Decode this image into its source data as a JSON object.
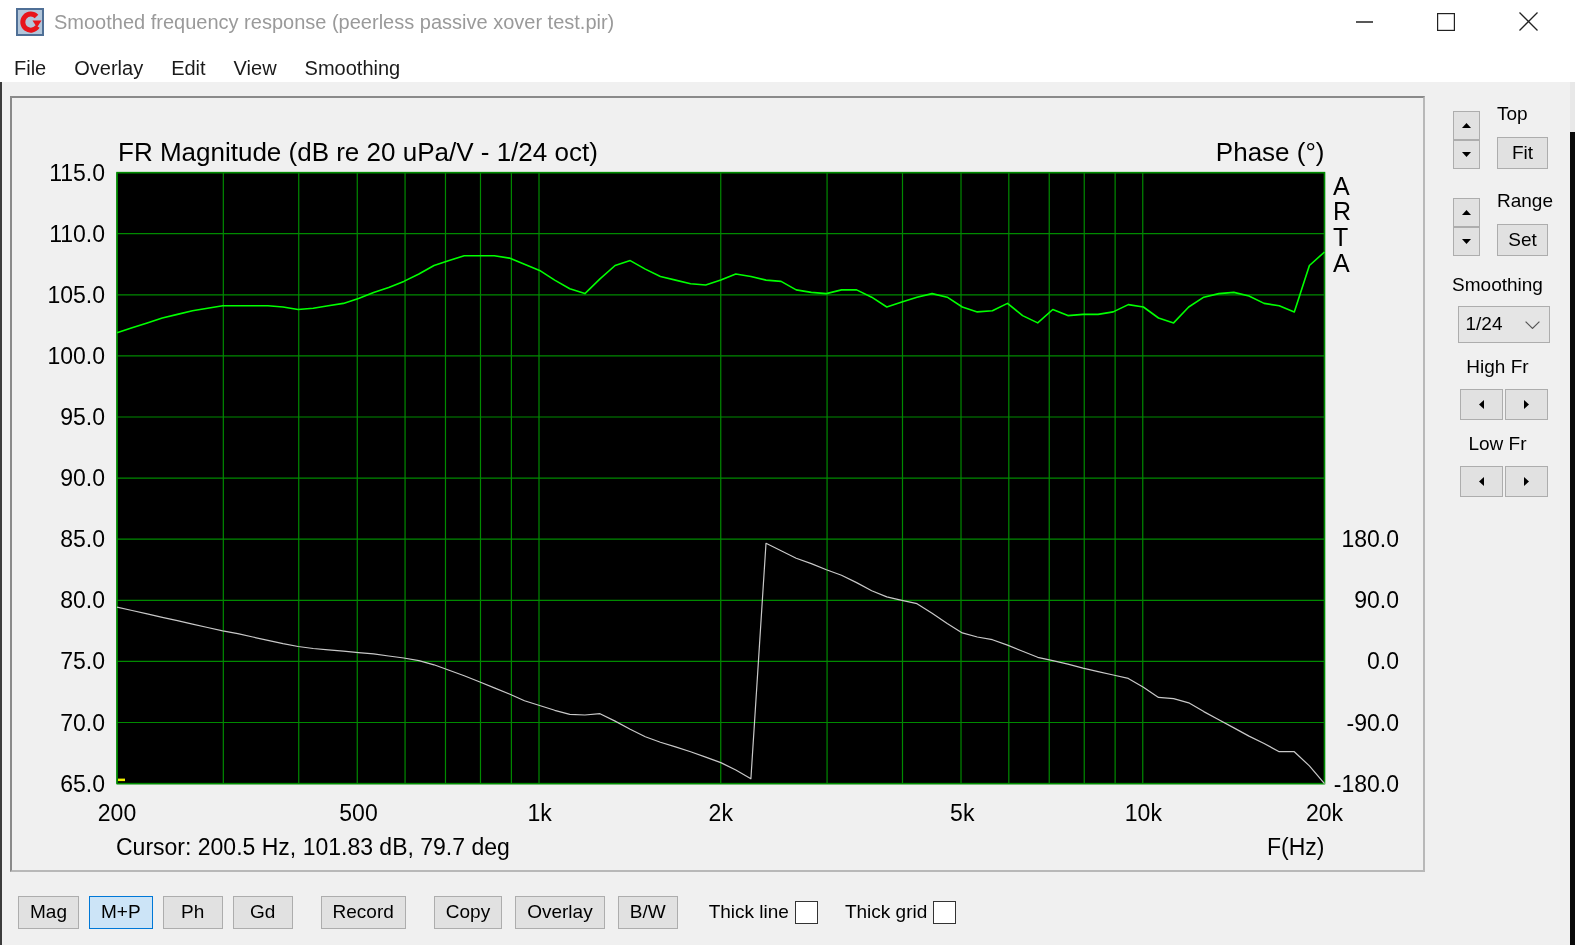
{
  "window": {
    "title": "Smoothed frequency response (peerless passive xover test.pir)"
  },
  "menu": [
    "File",
    "Overlay",
    "Edit",
    "View",
    "Smoothing"
  ],
  "plot_panel": {
    "chart_data": {
      "type": "line",
      "title": "FR Magnitude (dB re 20 uPa/V - 1/24 oct)",
      "xlabel": "F(Hz)",
      "grid": true,
      "categories": [
        "200",
        null,
        null,
        null,
        null,
        null,
        null,
        null,
        null,
        null,
        null,
        null,
        null,
        null,
        null,
        null,
        "500",
        null,
        null,
        null,
        null,
        null,
        null,
        null,
        null,
        null,
        null,
        null,
        "1k",
        null,
        null,
        null,
        null,
        null,
        null,
        null,
        null,
        null,
        null,
        null,
        "2k",
        null,
        null,
        null,
        null,
        null,
        null,
        null,
        null,
        null,
        null,
        null,
        null,
        null,
        null,
        null,
        "5k",
        null,
        null,
        null,
        null,
        null,
        null,
        null,
        null,
        null,
        null,
        null,
        "10k",
        null,
        null,
        null,
        null,
        null,
        null,
        null,
        null,
        null,
        null,
        null,
        "20k"
      ],
      "ylim": [
        65,
        115
      ],
      "yticks": [
        {
          "value": 115,
          "label": "115.0"
        },
        {
          "value": 110,
          "label": "110.0"
        },
        {
          "value": 105,
          "label": "105.0"
        },
        {
          "value": 100,
          "label": "100.0"
        },
        {
          "value": 95,
          "label": "95.0"
        },
        {
          "value": 90,
          "label": "90.0"
        },
        {
          "value": 85,
          "label": "85.0"
        },
        {
          "value": 80,
          "label": "80.0"
        },
        {
          "value": 75,
          "label": "75.0"
        },
        {
          "value": 70,
          "label": "70.0"
        },
        {
          "value": 65,
          "label": "65.0"
        }
      ],
      "y2label": "Phase (°)",
      "y2lim": [
        -180,
        720
      ],
      "y2ticks": [
        {
          "value": 180,
          "label": "180.0"
        },
        {
          "value": 90,
          "label": "90.0"
        },
        {
          "value": 0,
          "label": "0.0"
        },
        {
          "value": -90,
          "label": "-90.0"
        },
        {
          "value": -180,
          "label": "-180.0"
        }
      ],
      "series": [
        {
          "color": "#00ff00",
          "values": [
            101.9,
            102.3,
            102.7,
            103.1,
            103.4,
            103.7,
            103.9,
            104.1,
            104.1,
            104.1,
            104.1,
            104.0,
            103.8,
            103.9,
            104.1,
            104.3,
            104.7,
            105.2,
            105.6,
            106.1,
            106.7,
            107.4,
            107.8,
            108.2,
            108.2,
            108.2,
            108.0,
            107.5,
            107.0,
            106.2,
            105.5,
            105.1,
            106.3,
            107.4,
            107.8,
            107.1,
            106.5,
            106.2,
            105.9,
            105.8,
            106.2,
            106.7,
            106.5,
            106.2,
            106.1,
            105.4,
            105.2,
            105.1,
            105.4,
            105.4,
            104.8,
            104.0,
            104.4,
            104.8,
            105.1,
            104.8,
            104.0,
            103.6,
            103.7,
            104.3,
            103.3,
            102.7,
            103.8,
            103.3,
            103.4,
            103.4,
            103.6,
            104.2,
            104.0,
            103.1,
            102.7,
            104.0,
            104.8,
            105.1,
            105.2,
            104.9,
            104.3,
            104.1,
            103.6,
            107.4,
            108.5
          ]
        },
        {
          "color": "#c8c8c8",
          "axis": "y2",
          "values": [
            80,
            75,
            70,
            65,
            60,
            55,
            50,
            45,
            41,
            36,
            31,
            26,
            22,
            19,
            17,
            15,
            13,
            11,
            8,
            5,
            1,
            -5,
            -13,
            -21,
            -30,
            -39,
            -48,
            -58,
            -65,
            -72,
            -78,
            -79,
            -77,
            -88,
            -100,
            -111,
            -119,
            -126,
            -133,
            -141,
            -149,
            -160,
            -173,
            174,
            163,
            152,
            144,
            135,
            127,
            116,
            104,
            95,
            90,
            85,
            71,
            56,
            42,
            36,
            32,
            24,
            15,
            6,
            1,
            -4,
            -10,
            -15,
            -20,
            -25,
            -38,
            -53,
            -55,
            -61,
            -74,
            -86,
            -98,
            -110,
            -121,
            -133,
            -133,
            -154,
            -180
          ]
        }
      ]
    },
    "side_label": "ARTA",
    "cursor_readout": "Cursor: 200.5 Hz, 101.83 dB, 79.7 deg"
  },
  "side_panel": {
    "controls": [
      {
        "kind": "spin",
        "label": "Top",
        "button": "Fit"
      },
      {
        "kind": "spin",
        "label": "Range",
        "button": "Set"
      },
      {
        "kind": "dropdown",
        "label": "Smoothing",
        "value": "1/24"
      },
      {
        "kind": "stepper",
        "label": "High Fr"
      },
      {
        "kind": "stepper",
        "label": "Low Fr"
      }
    ]
  },
  "toolbar": {
    "button_groups": [
      [
        {
          "label": "Mag",
          "selected": false
        },
        {
          "label": "M+P",
          "selected": true
        },
        {
          "label": "Ph",
          "selected": false
        },
        {
          "label": "Gd",
          "selected": false
        }
      ],
      [
        {
          "label": "Record",
          "selected": false
        }
      ],
      [
        {
          "label": "Copy",
          "selected": false
        },
        {
          "label": "Overlay",
          "selected": false
        },
        {
          "label": "B/W",
          "selected": false
        }
      ]
    ],
    "checkboxes": [
      {
        "label": "Thick line",
        "checked": false
      },
      {
        "label": "Thick grid",
        "checked": false
      }
    ]
  }
}
